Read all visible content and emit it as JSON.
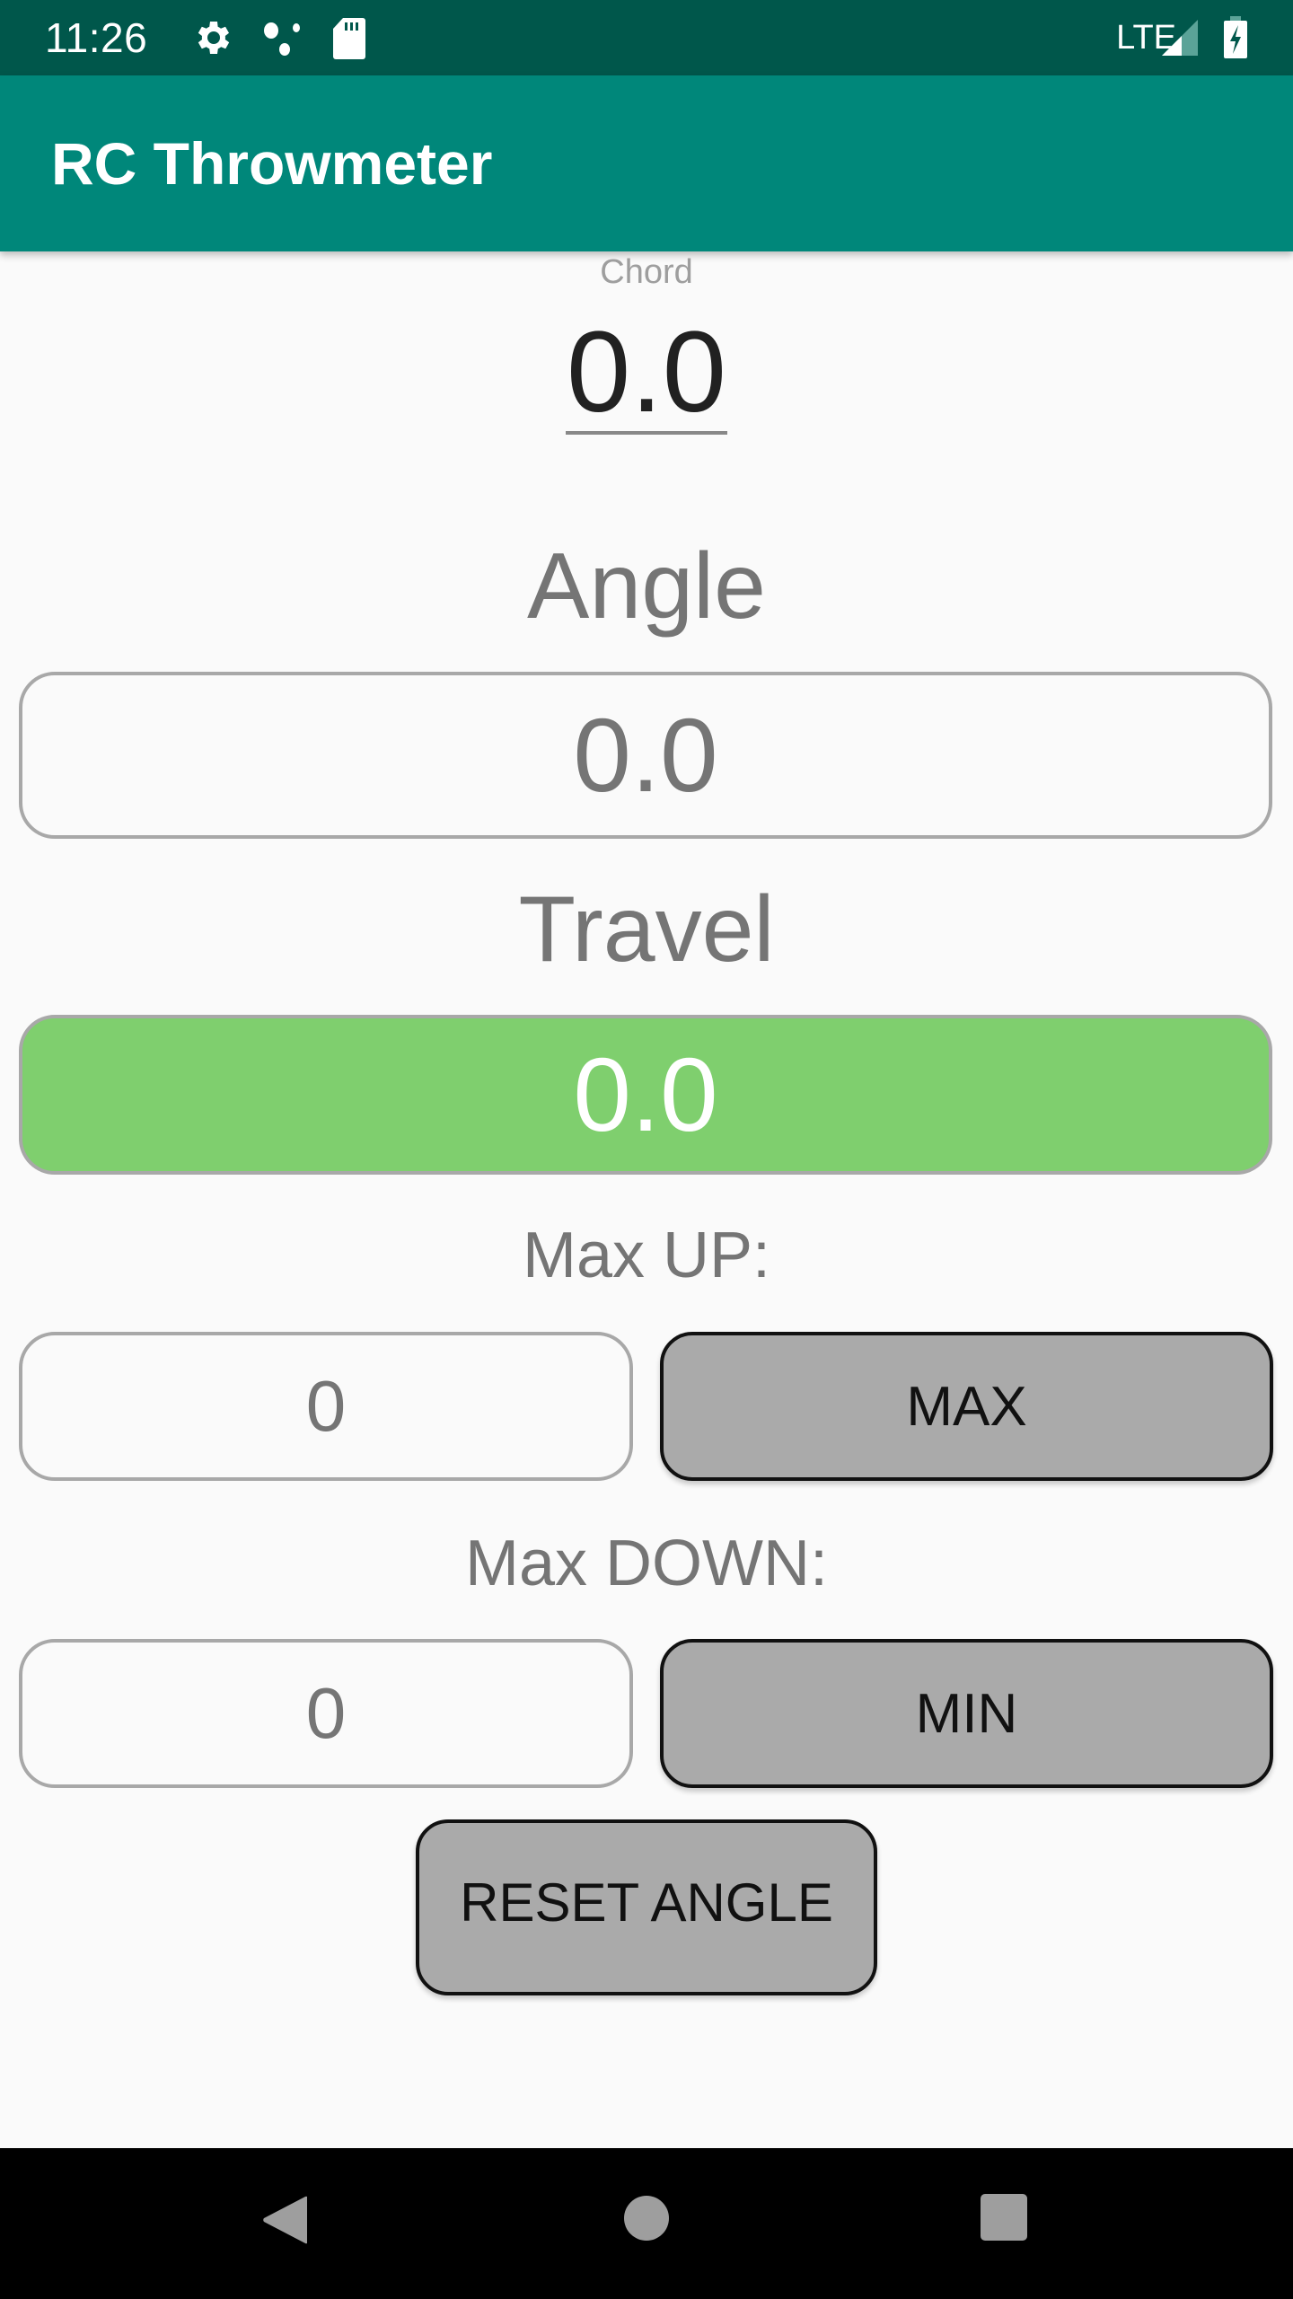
{
  "status_bar": {
    "time": "11:26",
    "icons": [
      "gear-icon",
      "assistant-dots-icon",
      "sd-card-icon"
    ],
    "network": "LTE",
    "right_icons": [
      "signal-icon",
      "battery-charging-icon"
    ]
  },
  "app_bar": {
    "title": "RC Throwmeter"
  },
  "chord": {
    "label": "Chord",
    "value": "0.0"
  },
  "angle": {
    "label": "Angle",
    "value": "0.0"
  },
  "travel": {
    "label": "Travel",
    "value": "0.0",
    "color": "#7FCF6E"
  },
  "max_up": {
    "label": "Max UP:",
    "value": "0",
    "button_label": "MAX"
  },
  "max_down": {
    "label": "Max DOWN:",
    "value": "0",
    "button_label": "MIN"
  },
  "reset_button": {
    "label": "RESET ANGLE"
  },
  "nav_bar": {
    "buttons": [
      "back-icon",
      "home-icon",
      "recents-icon"
    ]
  },
  "colors": {
    "status_bar": "#00574B",
    "app_bar": "#00877A",
    "button_gray": "#AAAAAA"
  }
}
